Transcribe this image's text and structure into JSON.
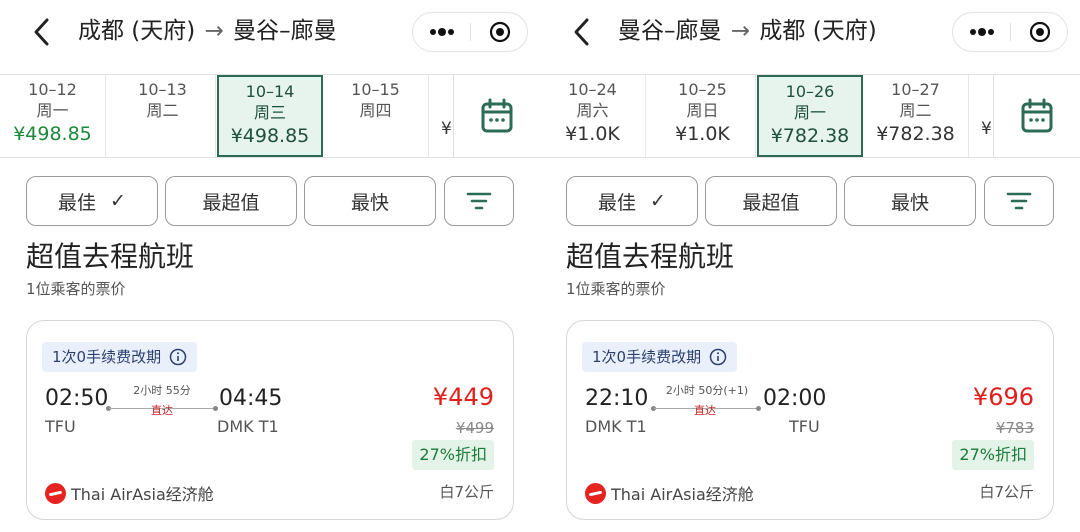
{
  "panels": [
    {
      "header": {
        "from": "成都 (天府)",
        "arrow": "→",
        "to": "曼谷–廊曼"
      },
      "dates": [
        {
          "date": "10–12",
          "weekday": "周一",
          "price": "¥498.85",
          "green": true,
          "selected": false
        },
        {
          "date": "10–13",
          "weekday": "周二",
          "price": "",
          "green": false,
          "selected": false
        },
        {
          "date": "10–14",
          "weekday": "周三",
          "price": "¥498.85",
          "green": false,
          "selected": true
        },
        {
          "date": "10–15",
          "weekday": "周四",
          "price": "",
          "green": false,
          "selected": false
        }
      ],
      "partial_price": "¥",
      "sort": {
        "best": "最佳",
        "best_check": "✓",
        "value": "最超值",
        "fastest": "最快"
      },
      "section_title": "超值去程航班",
      "section_subtitle": "1位乘客的票价",
      "card": {
        "tag": "1次0手续费改期",
        "dep_time": "02:50",
        "dep_code": "TFU",
        "duration": "2小时 55分",
        "direct": "直达",
        "arr_time": "04:45",
        "arr_code": "DMK T1",
        "price": "¥449",
        "old_price": "¥499",
        "discount": "27%折扣",
        "airline": "Thai AirAsia经济舱",
        "baggage": "白7公斤"
      }
    },
    {
      "header": {
        "from": "曼谷–廊曼",
        "arrow": "→",
        "to": "成都 (天府)"
      },
      "dates": [
        {
          "date": "10–24",
          "weekday": "周六",
          "price": "¥1.0K",
          "green": false,
          "selected": false
        },
        {
          "date": "10–25",
          "weekday": "周日",
          "price": "¥1.0K",
          "green": false,
          "selected": false
        },
        {
          "date": "10–26",
          "weekday": "周一",
          "price": "¥782.38",
          "green": false,
          "selected": true
        },
        {
          "date": "10–27",
          "weekday": "周二",
          "price": "¥782.38",
          "green": false,
          "selected": false
        }
      ],
      "partial_price": "¥",
      "sort": {
        "best": "最佳",
        "best_check": "✓",
        "value": "最超值",
        "fastest": "最快"
      },
      "section_title": "超值去程航班",
      "section_subtitle": "1位乘客的票价",
      "card": {
        "tag": "1次0手续费改期",
        "dep_time": "22:10",
        "dep_code": "DMK T1",
        "duration": "2小时 50分(+1)",
        "direct": "直达",
        "arr_time": "02:00",
        "arr_code": "TFU",
        "price": "¥696",
        "old_price": "¥783",
        "discount": "27%折扣",
        "airline": "Thai AirAsia经济舱",
        "baggage": "白7公斤"
      }
    }
  ],
  "icons": {
    "back": "chevron-left-icon",
    "more": "more-dots-icon",
    "target": "target-icon",
    "calendar": "calendar-icon",
    "filter": "filter-icon",
    "info": "info-icon",
    "airline_logo": "airasia-logo-icon"
  },
  "colors": {
    "selected_date_border": "#2c6b55",
    "selected_date_bg": "#e7f4ee",
    "price_red": "#e0201c",
    "discount_green": "#1c7a3a",
    "tag_bg": "#eaf0fb",
    "low_price_green": "#1a8a3a"
  }
}
